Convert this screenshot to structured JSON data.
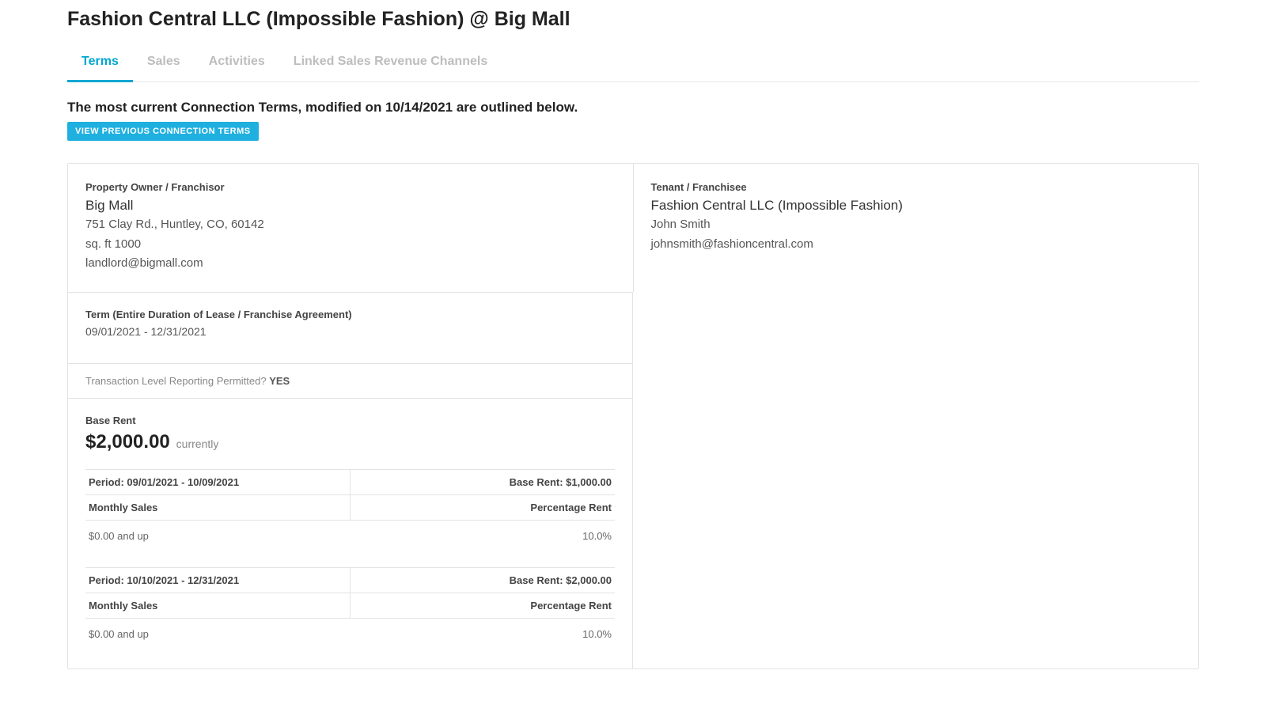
{
  "header": {
    "title": "Fashion Central LLC (Impossible Fashion) @ Big Mall"
  },
  "tabs": [
    {
      "label": "Terms",
      "active": true
    },
    {
      "label": "Sales",
      "active": false
    },
    {
      "label": "Activities",
      "active": false
    },
    {
      "label": "Linked Sales Revenue Channels",
      "active": false
    }
  ],
  "intro": "The most current Connection Terms, modified on 10/14/2021 are outlined below.",
  "view_prev_button": "VIEW PREVIOUS CONNECTION TERMS",
  "owner": {
    "label": "Property Owner / Franchisor",
    "name": "Big Mall",
    "address": "751 Clay Rd., Huntley, CO, 60142",
    "sqft": "sq. ft 1000",
    "email": "landlord@bigmall.com"
  },
  "tenant": {
    "label": "Tenant / Franchisee",
    "name": "Fashion Central LLC (Impossible Fashion)",
    "contact": "John Smith",
    "email": "johnsmith@fashioncentral.com"
  },
  "term": {
    "label": "Term (Entire Duration of Lease / Franchise Agreement)",
    "value": "09/01/2021 - 12/31/2021"
  },
  "txn": {
    "label": "Transaction Level Reporting Permitted? ",
    "value": "YES"
  },
  "base_rent": {
    "label": "Base Rent",
    "amount": "$2,000.00",
    "currently": "currently"
  },
  "periods": [
    {
      "period_label": "Period: 09/01/2021 - 10/09/2021",
      "base_rent_label": "Base Rent: $1,000.00",
      "monthly_sales_label": "Monthly Sales",
      "percentage_rent_label": "Percentage Rent",
      "tier_range": "$0.00 and up",
      "tier_pct": "10.0%"
    },
    {
      "period_label": "Period: 10/10/2021 - 12/31/2021",
      "base_rent_label": "Base Rent: $2,000.00",
      "monthly_sales_label": "Monthly Sales",
      "percentage_rent_label": "Percentage Rent",
      "tier_range": "$0.00 and up",
      "tier_pct": "10.0%"
    }
  ]
}
